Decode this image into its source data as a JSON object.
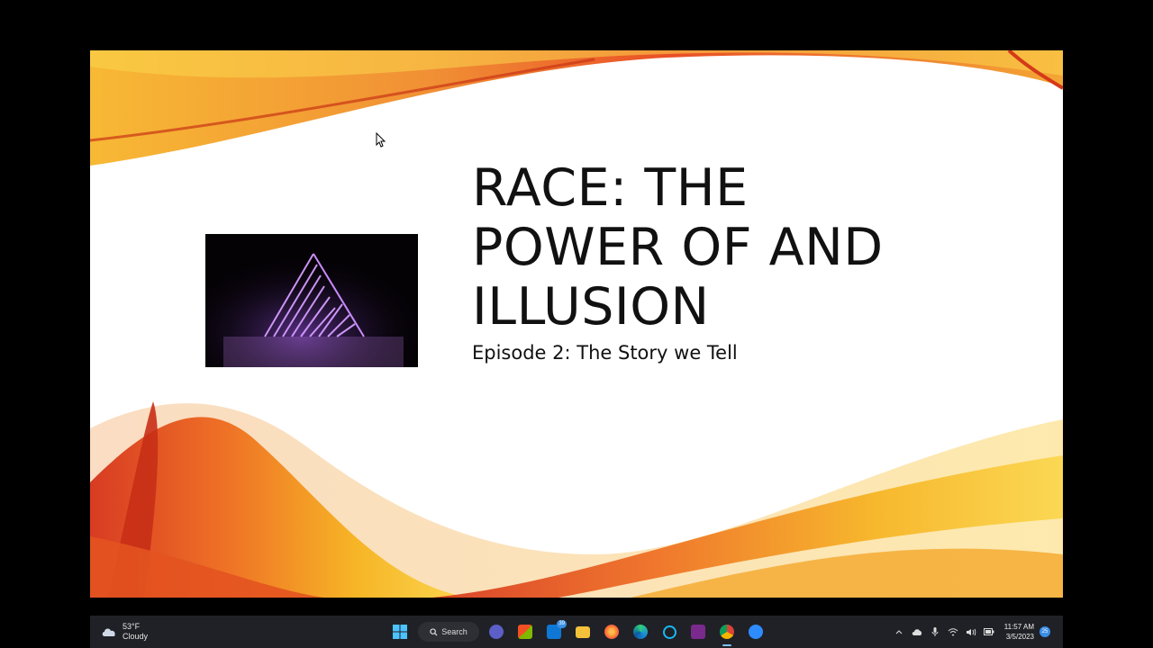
{
  "slide": {
    "title_lines": [
      "RACE: THE",
      "POWER OF AND",
      "ILLUSION"
    ],
    "subtitle": "Episode 2: The Story we Tell"
  },
  "taskbar": {
    "weather": {
      "temp": "53°F",
      "condition": "Cloudy",
      "icon": "cloud-icon"
    },
    "search_label": "Search",
    "apps": [
      {
        "name": "start",
        "icon": "windows-icon"
      },
      {
        "name": "meet",
        "icon": "video-chat-icon"
      },
      {
        "name": "store",
        "icon": "store-icon"
      },
      {
        "name": "mail",
        "icon": "mail-icon",
        "badge": "39"
      },
      {
        "name": "file-explorer",
        "icon": "folder-icon"
      },
      {
        "name": "firefox",
        "icon": "firefox-icon"
      },
      {
        "name": "edge",
        "icon": "edge-icon"
      },
      {
        "name": "alexa",
        "icon": "alexa-icon"
      },
      {
        "name": "pdf-app",
        "icon": "pdf-icon"
      },
      {
        "name": "chrome",
        "icon": "chrome-icon"
      },
      {
        "name": "zoom",
        "icon": "zoom-icon",
        "label": "zoom"
      }
    ],
    "tray": {
      "time": "11:57 AM",
      "date": "3/5/2023",
      "notification_count": "25"
    }
  },
  "colors": {
    "swoosh_orange": "#e8461a",
    "swoosh_yellow": "#f6b21e",
    "taskbar_bg": "#202126",
    "accent_blue": "#3a8ee6"
  }
}
